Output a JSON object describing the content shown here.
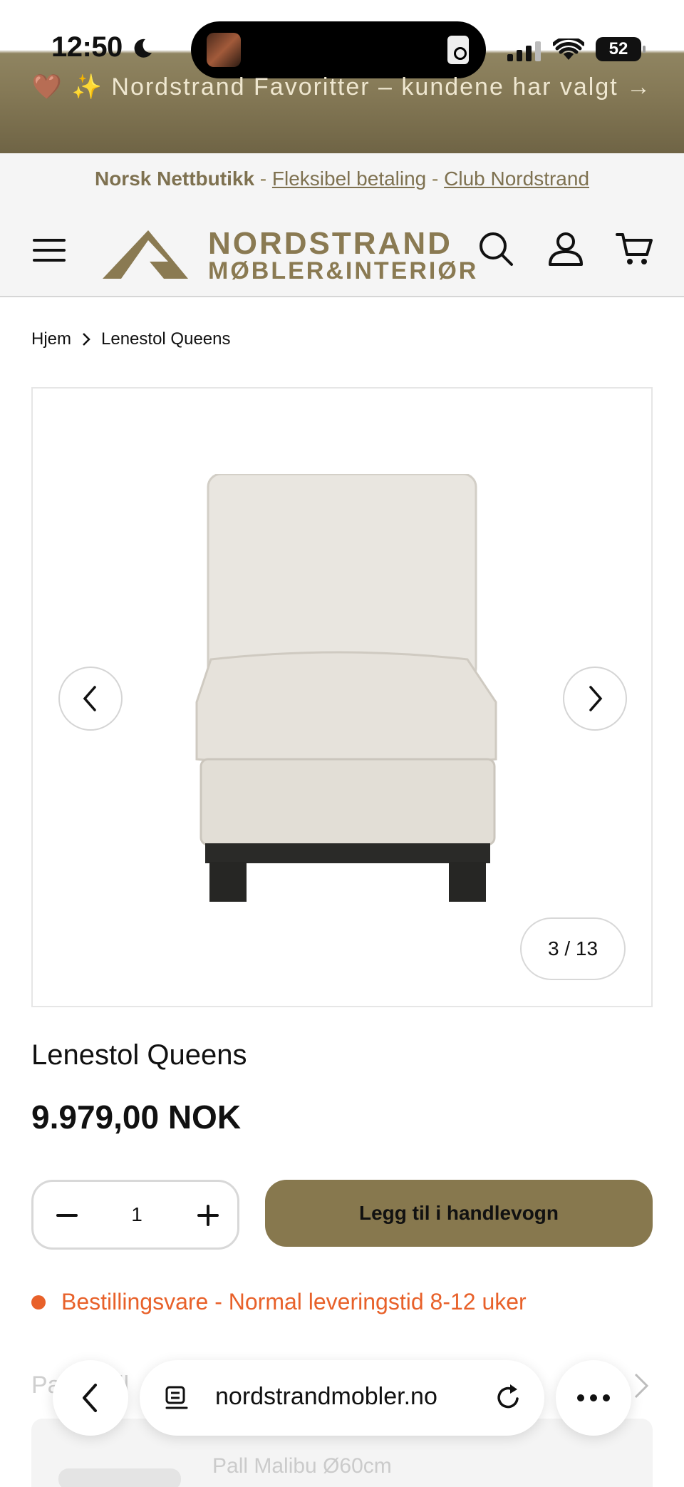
{
  "status_bar": {
    "time": "12:50",
    "battery": "52"
  },
  "promo": {
    "text": "🤎 ✨ Nordstrand Favoritter – kundene har valgt →"
  },
  "sub_banner": {
    "brand": "Norsk Nettbutikk",
    "sep1": " - ",
    "link1": "Fleksibel betaling",
    "sep2": " - ",
    "link2": "Club Nordstrand"
  },
  "header": {
    "logo_line1": "NORDSTRAND",
    "logo_line2": "MØBLER&INTERIØR",
    "brand_color": "#8a7a52"
  },
  "breadcrumb": {
    "home": "Hjem",
    "current": "Lenestol Queens"
  },
  "gallery": {
    "counter": "3 / 13"
  },
  "product": {
    "title": "Lenestol Queens",
    "price": "9.979,00 NOK",
    "quantity": "1",
    "add_to_cart": "Legg til i handlevogn",
    "stock": "Bestillingsvare - Normal leveringstid 8-12 uker",
    "stock_color": "#e8612a"
  },
  "related": {
    "label_prefix": "Pa",
    "label_suffix": "il",
    "item_name": "Pall Malibu Ø60cm"
  },
  "browser": {
    "url": "nordstrandmobler.no"
  }
}
